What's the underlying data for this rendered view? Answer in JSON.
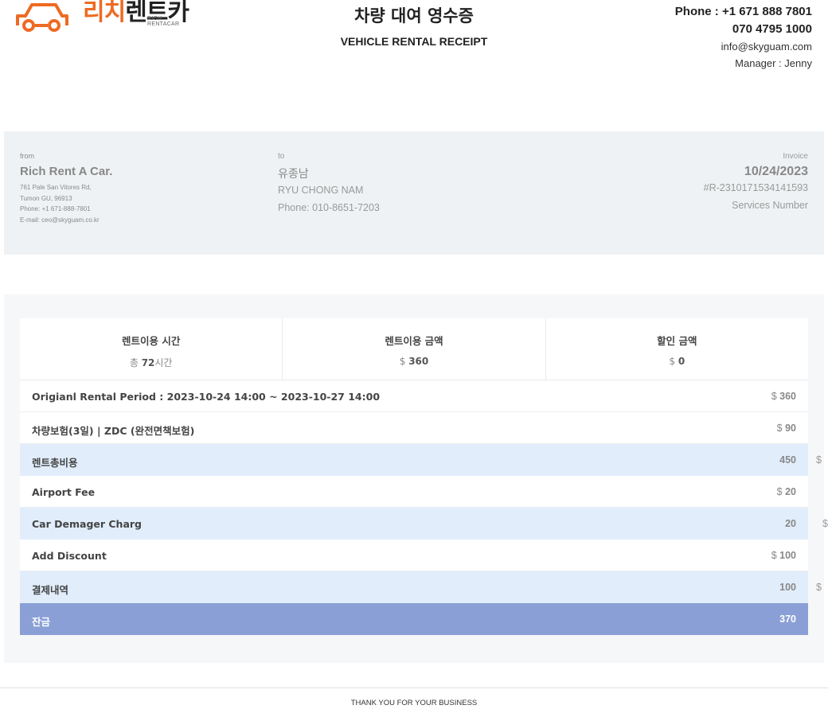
{
  "header": {
    "logo_kr_a": "리치",
    "logo_kr_b": "렌트카",
    "logo_en": "RICH RENTACAR",
    "title_kr": "차량 대여 영수증",
    "title_en": "VEHICLE RENTAL RECEIPT",
    "phone1": "Phone : +1 671 888 7801",
    "phone2": "070 4795 1000",
    "email": "info@skyguam.com",
    "manager": "Manager : Jenny"
  },
  "from": {
    "label": "from",
    "name": "Rich Rent A Car.",
    "address1": "761 Pale San Vitores Rd,",
    "address2": "Tumon GU, 96913",
    "phone": "Phone: +1 671-888-7801",
    "email": "E-mail: ceo@skyguam.co.kr"
  },
  "to": {
    "label": "to",
    "name_kr": "유종남",
    "name_en": "RYU CHONG NAM",
    "phone": "Phone: 010-8651-7203"
  },
  "invoice": {
    "label": "Invoice",
    "date": "10/24/2023",
    "number": "#R-2310171534141593",
    "services": "Services Number"
  },
  "summary": [
    {
      "heading": "렌트이용 시간",
      "prefix": "총 ",
      "value": "72",
      "suffix": "시간"
    },
    {
      "heading": "렌트이용 금액",
      "prefix": "$ ",
      "value": "360",
      "suffix": ""
    },
    {
      "heading": "할인 금액",
      "prefix": "$ ",
      "value": "0",
      "suffix": ""
    }
  ],
  "currency": "$",
  "items": [
    {
      "label": "Origianl Rental Period : 2023-10-24 14:00 ~ 2023-10-27 14:00",
      "value": "360"
    },
    {
      "label": "차량보험(3일) | ZDC (완전면책보험)",
      "value": "90"
    },
    {
      "label": "렌트총비용",
      "value": "450"
    },
    {
      "label": "Airport Fee",
      "value": "20"
    },
    {
      "label": "Car Demager Charg",
      "value": "20"
    },
    {
      "label": "Add Discount",
      "value": "100"
    },
    {
      "label": "결제내역",
      "value": "100"
    },
    {
      "label": "잔금",
      "value": "370"
    }
  ],
  "colors": {
    "brand_orange": "#ee6a23",
    "highlight_row": "#e1edfb",
    "total_row": "#8a9fd5"
  },
  "footer": "THANK YOU FOR YOUR BUSINESS"
}
